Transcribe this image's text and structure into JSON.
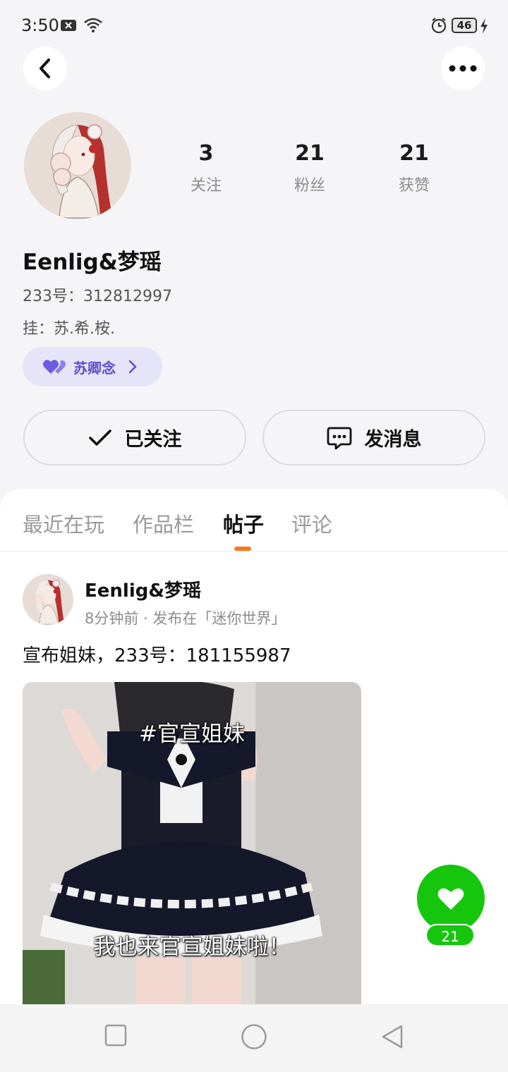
{
  "status_bar": {
    "time": "3:50",
    "battery": "46"
  },
  "profile": {
    "stats": [
      {
        "value": "3",
        "label": "关注"
      },
      {
        "value": "21",
        "label": "粉丝"
      },
      {
        "value": "21",
        "label": "获赞"
      }
    ],
    "username": "Eenlig&梦瑶",
    "id_line": "233号：312812997",
    "signature": "挂：苏.希.桉.",
    "group_chip": "苏卿念",
    "follow_button": "已关注",
    "message_button": "发消息"
  },
  "tabs": [
    {
      "label": "最近在玩",
      "active": false
    },
    {
      "label": "作品栏",
      "active": false
    },
    {
      "label": "帖子",
      "active": true
    },
    {
      "label": "评论",
      "active": false
    }
  ],
  "post": {
    "author": "Eenlig&梦瑶",
    "meta": "8分钟前 · 发布在「迷你世界」",
    "text": "宣布姐妹，233号：181155987",
    "media_caption_top": "#官宣姐妹",
    "media_caption_bottom": "我也来官宣姐妹啦！",
    "like_count": "21"
  },
  "colors": {
    "accent_green": "#16c60c",
    "tab_indicator": "#f47a1f",
    "chip_bg": "#e6e4f8",
    "chip_text": "#5a4fd0"
  }
}
